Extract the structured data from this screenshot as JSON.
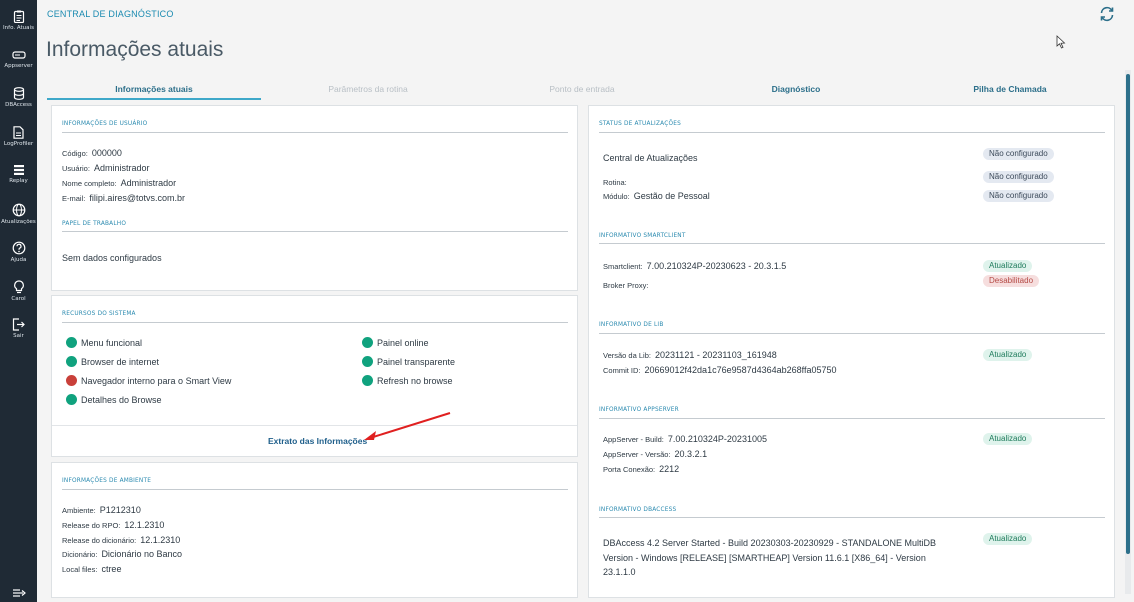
{
  "sidebar": {
    "items": [
      {
        "label": "Info. Atuais"
      },
      {
        "label": "Appserver"
      },
      {
        "label": "DBAccess"
      },
      {
        "label": "LogProfiler"
      },
      {
        "label": "Replay"
      },
      {
        "label": "Atualizações"
      },
      {
        "label": "Ajuda"
      },
      {
        "label": "Carol"
      },
      {
        "label": "Sair"
      }
    ]
  },
  "header": {
    "breadcrumb": "CENTRAL DE DIAGNÓSTICO",
    "title": "Informações atuais"
  },
  "tabs": [
    {
      "label": "Informações atuais"
    },
    {
      "label": "Parâmetros da rotina"
    },
    {
      "label": "Ponto de entrada"
    },
    {
      "label": "Diagnóstico"
    },
    {
      "label": "Pilha de Chamada"
    }
  ],
  "user_info": {
    "title": "INFORMAÇÕES DE USUÁRIO",
    "fields": [
      {
        "key": "Código:",
        "value": "000000"
      },
      {
        "key": "Usuário:",
        "value": "Administrador"
      },
      {
        "key": "Nome completo:",
        "value": "Administrador"
      },
      {
        "key": "E-mail:",
        "value": "filipi.aires@totvs.com.br"
      }
    ]
  },
  "work_role": {
    "title": "PAPEL DE TRABALHO",
    "text": "Sem dados configurados"
  },
  "resources": {
    "title": "RECURSOS DO SISTEMA",
    "left": [
      {
        "label": "Menu funcional",
        "status": "ok"
      },
      {
        "label": "Browser de internet",
        "status": "ok"
      },
      {
        "label": "Navegador interno para o Smart View",
        "status": "bad"
      },
      {
        "label": "Detalhes do Browse",
        "status": "ok"
      }
    ],
    "right": [
      {
        "label": "Painel online",
        "status": "ok"
      },
      {
        "label": "Painel transparente",
        "status": "ok"
      },
      {
        "label": "Refresh no browse",
        "status": "ok"
      }
    ],
    "link": "Extrato das Informações"
  },
  "environment": {
    "title": "INFORMAÇÕES DE AMBIENTE",
    "fields": [
      {
        "key": "Ambiente:",
        "value": "P1212310"
      },
      {
        "key": "Release do RPO:",
        "value": "12.1.2310"
      },
      {
        "key": "Release do dicionário:",
        "value": "12.1.2310"
      },
      {
        "key": "Dicionário:",
        "value": "Dicionário no Banco"
      },
      {
        "key": "Local files:",
        "value": "ctree"
      }
    ]
  },
  "update_status": {
    "title": "STATUS DE ATUALIZAÇÕES",
    "central": "Central de Atualizações",
    "rotina_key": "Rotina:",
    "modulo_key": "Módulo:",
    "modulo_value": "Gestão de Pessoal",
    "badges": [
      "Não configurado",
      "Não configurado",
      "Não configurado"
    ]
  },
  "smartclient": {
    "title": "INFORMATIVO SMARTCLIENT",
    "fields": [
      {
        "key": "Smartclient:",
        "value": "7.00.210324P-20230623 - 20.3.1.5"
      },
      {
        "key": "Broker Proxy:",
        "value": ""
      }
    ],
    "badges": [
      "Atualizado",
      "Desabilitado"
    ]
  },
  "lib": {
    "title": "INFORMATIVO DE LIB",
    "fields": [
      {
        "key": "Versão da Lib:",
        "value": "20231121 - 20231103_161948"
      },
      {
        "key": "Commit ID:",
        "value": "20669012f42da1c76e9587d4364ab268ffa05750"
      }
    ],
    "badge": "Atualizado"
  },
  "appserver": {
    "title": "INFORMATIVO APPSERVER",
    "fields": [
      {
        "key": "AppServer - Build:",
        "value": "7.00.210324P-20231005"
      },
      {
        "key": "AppServer - Versão:",
        "value": "20.3.2.1"
      },
      {
        "key": "Porta Conexão:",
        "value": "2212"
      }
    ],
    "badge": "Atualizado"
  },
  "dbaccess": {
    "title": "INFORMATIVO DBACCESS",
    "lines": [
      "DBAccess 4.2 Server Started - Build 20230303-20230929 - STANDALONE MultiDB",
      "Version - Windows [RELEASE] [SMARTHEAP] Version 11.6.1 [X86_64] - Version",
      "23.1.1.0"
    ],
    "badge": "Atualizado"
  },
  "colors": {
    "sidebar": "#1f2a35",
    "accent": "#3ea8c9",
    "ok": "#10a27e",
    "bad": "#c9403a",
    "annotation_arrow": "#e02020"
  }
}
